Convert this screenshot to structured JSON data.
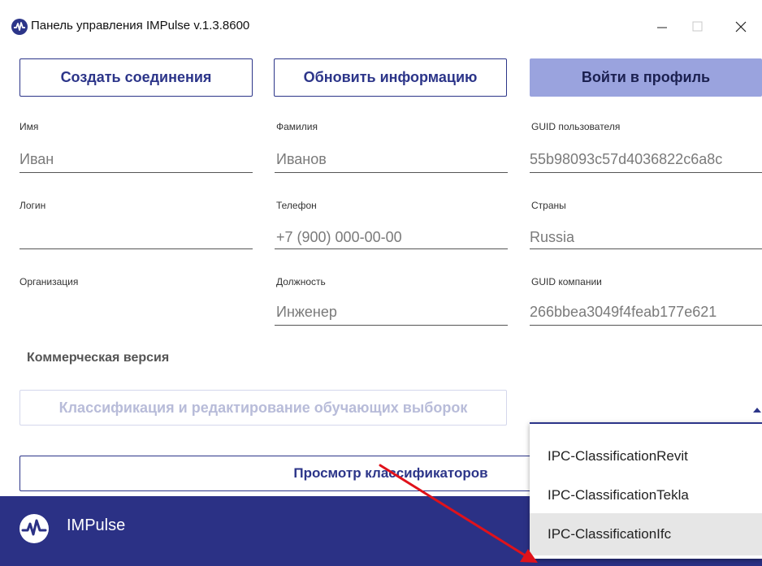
{
  "window": {
    "title": "Панель управления IMPulse v.1.3.8600",
    "minimize_glyph": "—",
    "maximize_glyph": "☐",
    "close_glyph": "✕"
  },
  "toolbar": {
    "create_connection_label": "Создать соединения",
    "refresh_info_label": "Обновить информацию",
    "login_label": "Войти в профиль"
  },
  "profile": {
    "first_name": {
      "label": "Имя",
      "value": "Иван"
    },
    "last_name": {
      "label": "Фамилия",
      "value": "Иванов"
    },
    "user_guid": {
      "label": "GUID пользователя",
      "value": "55b98093c57d4036822c6a8c"
    },
    "login": {
      "label": "Логин",
      "value": ""
    },
    "phone": {
      "label": "Телефон",
      "value": "+7 (900) 000-00-00"
    },
    "country": {
      "label": "Страны",
      "value": "Russia"
    },
    "organization": {
      "label": "Организация",
      "value": ""
    },
    "position": {
      "label": "Должность",
      "value": "Инженер"
    },
    "company_guid": {
      "label": "GUID компании",
      "value": "266bbea3049f4feab177e621"
    }
  },
  "commercial": {
    "section_title": "Коммерческая версия",
    "classify_label": "Классификация и редактирование обучающих выборок",
    "view_classifiers_label": "Просмотр классификаторов"
  },
  "dropdown": {
    "options": [
      "IPC-ClassificationRevit",
      "IPC-ClassificationTekla",
      "IPC-ClassificationIfc"
    ],
    "highlighted_index": 2
  },
  "footer": {
    "brand": "IMPulse"
  },
  "colors": {
    "brand": "#2c3589",
    "footer": "#2b3185",
    "filled_button": "#9aa3de",
    "arrow": "#e0121b"
  }
}
